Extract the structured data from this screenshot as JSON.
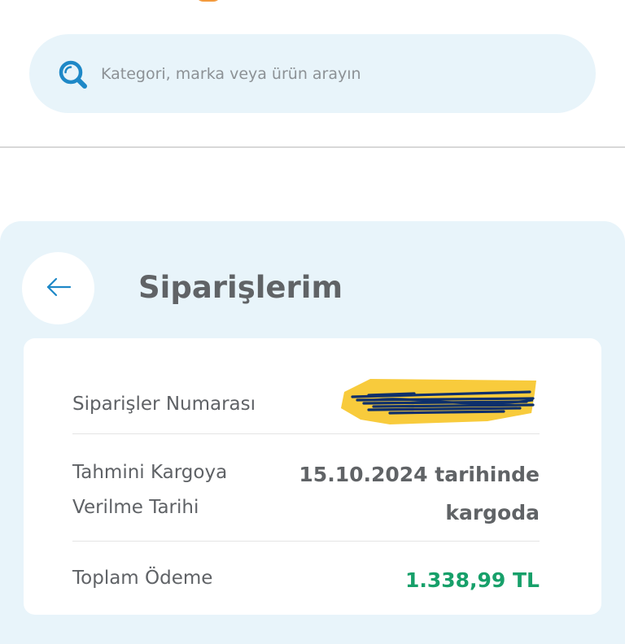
{
  "search": {
    "placeholder": "Kategori, marka veya ürün arayın"
  },
  "page": {
    "title": "Siparişlerim"
  },
  "order": {
    "number_label": "Siparişler Numarası",
    "estimated_label_line1": "Tahmini Kargoya",
    "estimated_label_line2": "Verilme Tarihi",
    "estimated_value_line1": "15.10.2024 tarihinde",
    "estimated_value_line2": "kargoda",
    "total_label": "Toplam Ödeme",
    "total_value": "1.338,99 TL"
  },
  "colors": {
    "accent_blue": "#1e88c7",
    "search_bg": "#e8f4fa",
    "price_green": "#17a06a",
    "redaction_yellow": "#f7c21a",
    "redaction_navy": "#0d2f6b"
  },
  "icons": {
    "search": "search-icon",
    "back": "arrow-left-icon"
  }
}
